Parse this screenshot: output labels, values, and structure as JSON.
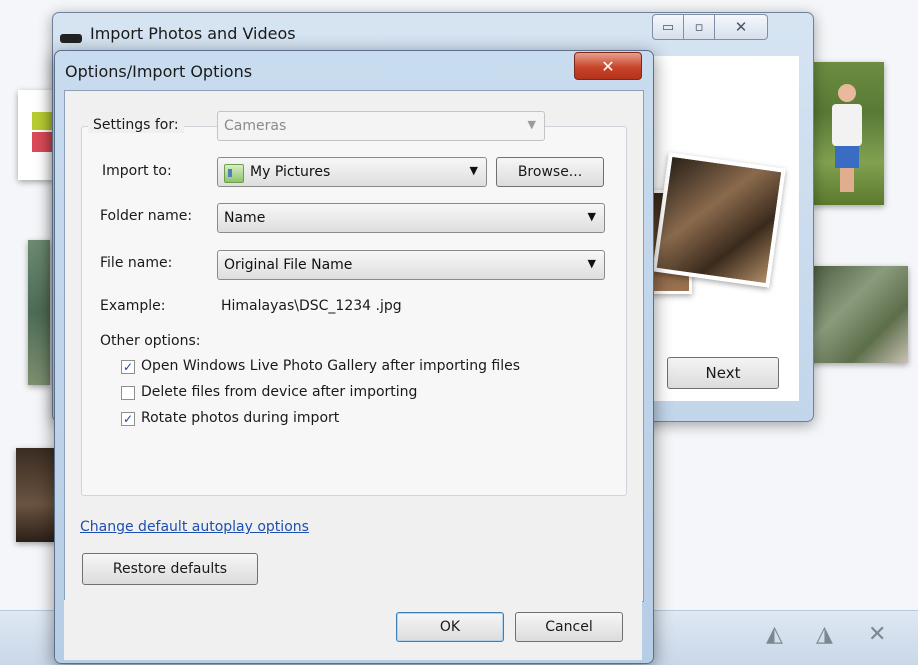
{
  "main_window": {
    "title": "Import Photos and Videos",
    "next_label": "Next",
    "caption_min": "▭",
    "caption_max": "▫",
    "caption_close": "✕"
  },
  "dialog": {
    "title": "Options/Import Options",
    "close_glyph": "✕",
    "settings_for_label": "Settings for:",
    "settings_for_value": "Cameras",
    "import_to_label": "Import to:",
    "import_to_value": "My Pictures",
    "browse_label": "Browse...",
    "folder_name_label": "Folder name:",
    "folder_name_value": "Name",
    "file_name_label": "File name:",
    "file_name_value": "Original File Name",
    "example_label": "Example:",
    "example_value": "Himalayas\\DSC_1234 .jpg",
    "other_options_label": "Other options:",
    "options": [
      {
        "label": "Open Windows Live Photo Gallery after importing files",
        "checked": true
      },
      {
        "label": "Delete files from device after importing",
        "checked": false
      },
      {
        "label": "Rotate photos during import",
        "checked": true
      }
    ],
    "autoplay_link": "Change default autoplay options",
    "restore_label": "Restore defaults",
    "ok_label": "OK",
    "cancel_label": "Cancel"
  },
  "icons": {
    "dropdown": "▼",
    "check": "✓",
    "taskbar": [
      "◭",
      "◮",
      "✕"
    ]
  },
  "colors": {
    "link": "#1c4fb0",
    "close_button": "#c8452b",
    "check_mark": "#20478a"
  }
}
